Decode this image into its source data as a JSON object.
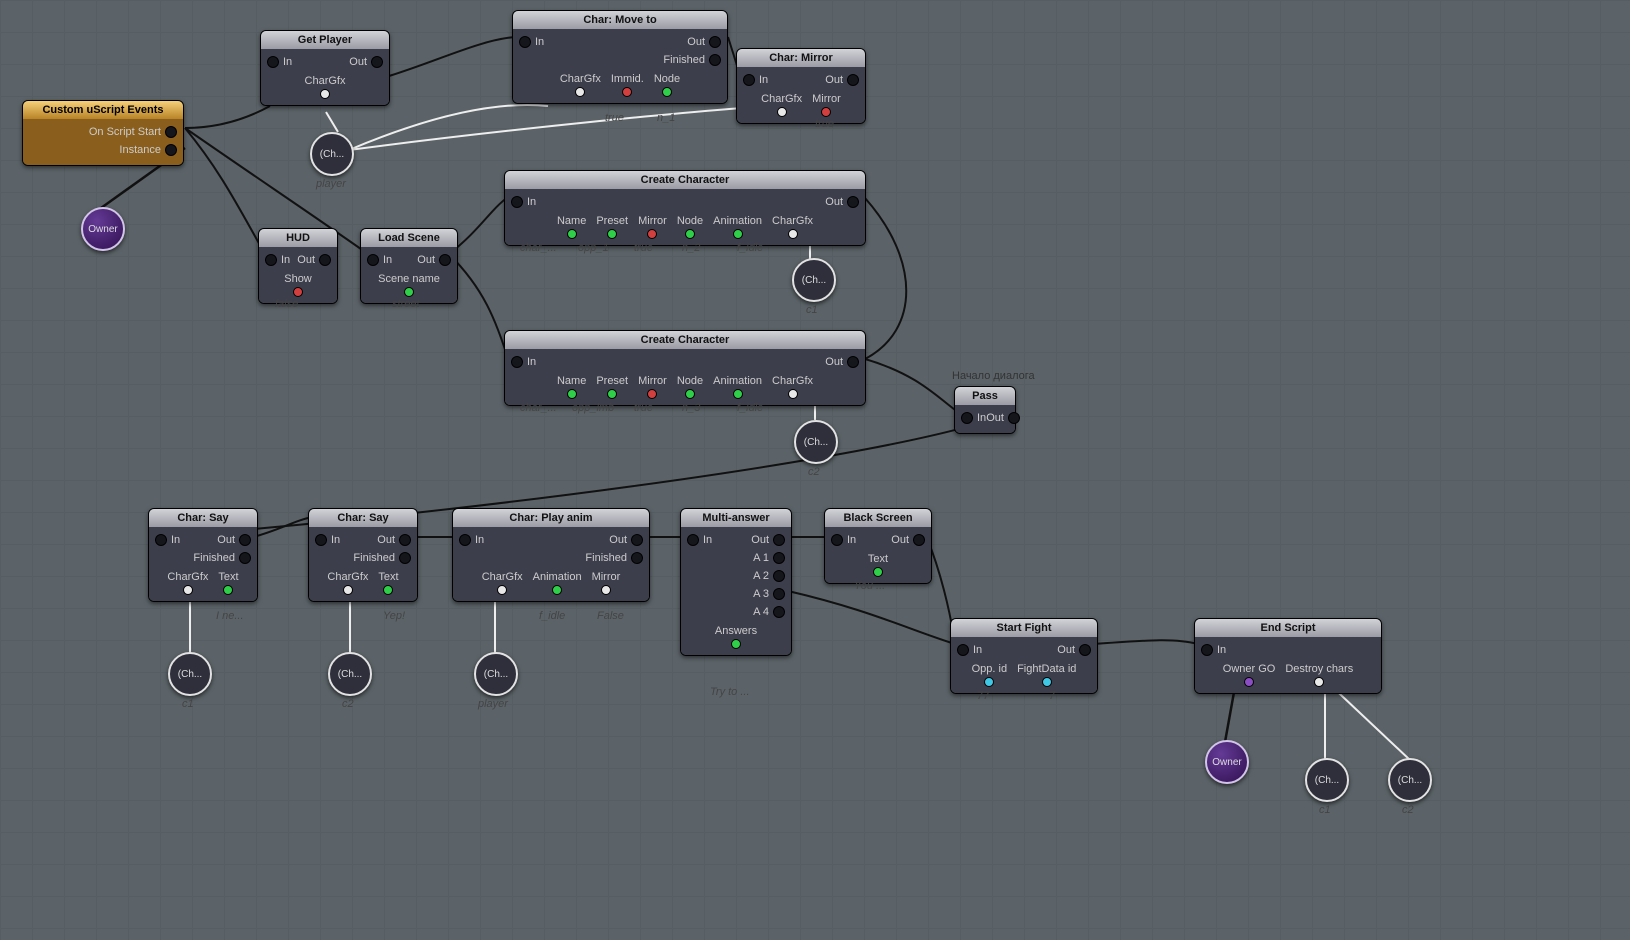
{
  "common": {
    "in": "In",
    "out": "Out",
    "finished": "Finished",
    "charGfx": "CharGfx"
  },
  "comments": {
    "dialogStart": "Начало диалога"
  },
  "orbs": {
    "owner": {
      "label": "Owner"
    },
    "ch": "(Ch...",
    "player": "player",
    "c1": "c1",
    "c2": "c2"
  },
  "nodes": {
    "events": {
      "title": "Custom uScript Events",
      "ports": {
        "onScriptStart": "On Script Start",
        "instance": "Instance"
      }
    },
    "getPlayer": {
      "title": "Get Player"
    },
    "hud": {
      "title": "HUD",
      "params": {
        "show": "Show"
      },
      "values": {
        "show": "false"
      }
    },
    "loadScene": {
      "title": "Load Scene",
      "params": {
        "sceneName": "Scene name"
      },
      "values": {
        "sceneName": "street"
      }
    },
    "moveTo": {
      "title": "Char: Move to",
      "params": {
        "immid": "Immid.",
        "node": "Node"
      },
      "values": {
        "immid": "true",
        "node": "n_1"
      }
    },
    "mirror": {
      "title": "Char: Mirror",
      "params": {
        "mirror": "Mirror"
      },
      "values": {
        "mirror": "true"
      }
    },
    "create1": {
      "title": "Create Character",
      "params": {
        "name": "Name",
        "preset": "Preset",
        "mirror": "Mirror",
        "node": "Node",
        "animation": "Animation"
      },
      "values": {
        "name": "char_...",
        "preset": "opp_1",
        "mirror": "true",
        "node": "n_2",
        "animation": "f_idle"
      }
    },
    "create2": {
      "title": "Create Character",
      "params": {
        "name": "Name",
        "preset": "Preset",
        "mirror": "Mirror",
        "node": "Node",
        "animation": "Animation"
      },
      "values": {
        "name": "char_...",
        "preset": "opp_lmb",
        "mirror": "true",
        "node": "n_3",
        "animation": "f_idle"
      }
    },
    "pass": {
      "title": "Pass"
    },
    "say1": {
      "title": "Char: Say",
      "params": {
        "text": "Text"
      },
      "values": {
        "text": "I ne..."
      }
    },
    "say2": {
      "title": "Char: Say",
      "params": {
        "text": "Text"
      },
      "values": {
        "text": "Yep!"
      }
    },
    "playAnim": {
      "title": "Char: Play anim",
      "params": {
        "animation": "Animation",
        "mirror": "Mirror"
      },
      "values": {
        "animation": "f_idle",
        "mirror": "False"
      }
    },
    "multi": {
      "title": "Multi-answer",
      "ports": {
        "a1": "A 1",
        "a2": "A 2",
        "a3": "A 3",
        "a4": "A 4"
      },
      "params": {
        "answers": "Answers"
      },
      "values": {
        "answers": "Try to ..."
      }
    },
    "black": {
      "title": "Black Screen",
      "params": {
        "text": "Text"
      },
      "values": {
        "text": "You ..."
      }
    },
    "fight": {
      "title": "Start Fight",
      "params": {
        "oppId": "Opp. id",
        "fightData": "FightData id"
      },
      "values": {
        "oppId": "77",
        "fightData": "7"
      }
    },
    "end": {
      "title": "End Script",
      "params": {
        "ownerGO": "Owner GO",
        "destroy": "Destroy chars"
      }
    }
  }
}
